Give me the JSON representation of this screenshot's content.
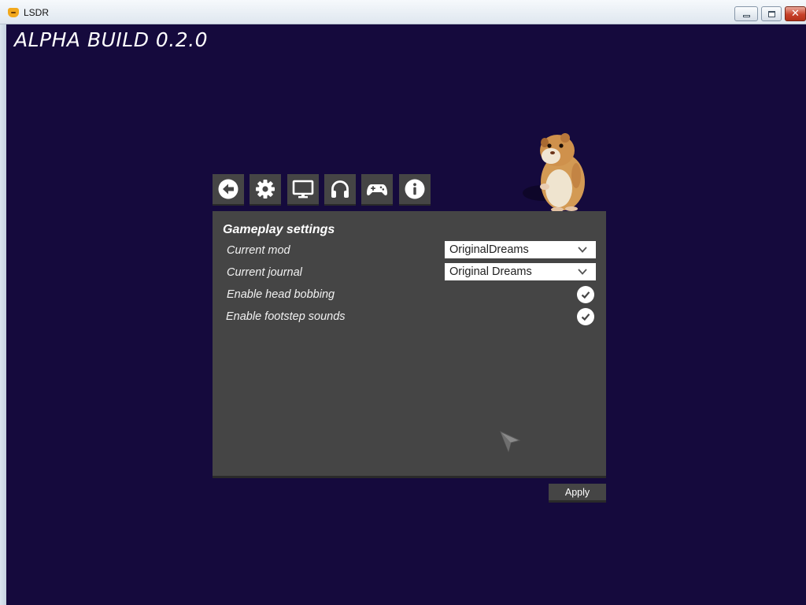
{
  "window": {
    "title": "LSDR",
    "icon": "lsdr-app-icon",
    "controls": [
      "minimize-icon",
      "maximize-icon",
      "close-icon"
    ],
    "close_glyph": "✕"
  },
  "build": {
    "label": "ALPHA BUILD 0.2.0"
  },
  "tabs": [
    {
      "icon": "back-arrow-icon"
    },
    {
      "icon": "gear-icon"
    },
    {
      "icon": "monitor-icon"
    },
    {
      "icon": "headphones-icon"
    },
    {
      "icon": "gamepad-icon"
    },
    {
      "icon": "info-icon"
    }
  ],
  "panel": {
    "title": "Gameplay settings",
    "rows": [
      {
        "label": "Current mod",
        "type": "dropdown",
        "value": "OriginalDreams"
      },
      {
        "label": "Current journal",
        "type": "dropdown",
        "value": "Original Dreams"
      },
      {
        "label": "Enable head bobbing",
        "type": "checkbox",
        "checked": true
      },
      {
        "label": "Enable footstep sounds",
        "type": "checkbox",
        "checked": true
      }
    ]
  },
  "apply": {
    "label": "Apply"
  },
  "colors": {
    "background": "#150a3d",
    "panel": "#454545",
    "panel_shadow": "#2a2a2a",
    "text": "#ffffff"
  }
}
